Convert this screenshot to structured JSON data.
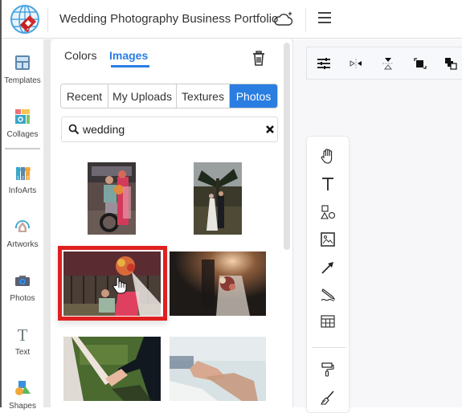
{
  "header": {
    "title": "Wedding Photography Business Portfolio",
    "logo_icon": "globe-diamond-logo",
    "cloud_icon": "cloud-sync-icon",
    "menu_icon": "hamburger-menu-icon"
  },
  "rail": {
    "items": [
      {
        "label": "Templates",
        "icon": "templates-icon"
      },
      {
        "label": "Collages",
        "icon": "collages-icon"
      },
      {
        "label": "InfoArts",
        "icon": "infoarts-icon"
      },
      {
        "label": "Artworks",
        "icon": "artworks-icon"
      },
      {
        "label": "Photos",
        "icon": "camera-icon"
      },
      {
        "label": "Text",
        "icon": "text-icon"
      },
      {
        "label": "Shapes",
        "icon": "shapes-icon"
      }
    ]
  },
  "panel": {
    "tabs": [
      {
        "label": "Colors",
        "active": false
      },
      {
        "label": "Images",
        "active": true
      }
    ],
    "trash_icon": "trash-icon",
    "sources": [
      {
        "label": "Recent",
        "active": false
      },
      {
        "label": "My Uploads",
        "active": false
      },
      {
        "label": "Textures",
        "active": false
      },
      {
        "label": "Photos",
        "active": true
      }
    ],
    "search": {
      "value": "wedding",
      "placeholder": "Search"
    },
    "results": [
      {
        "description": "Couple with wheelchair and bouquet in graffiti street",
        "orientation": "portrait",
        "selected": false
      },
      {
        "description": "Bride and groom walking under palm tree",
        "orientation": "portrait",
        "selected": false
      },
      {
        "description": "Groom and bride with colorful bouquet by graffiti fence",
        "orientation": "landscape",
        "selected": true
      },
      {
        "description": "Bride holding bouquet in warm backlight",
        "orientation": "landscape",
        "selected": false
      },
      {
        "description": "Couple holding hands on grass",
        "orientation": "landscape",
        "selected": false
      },
      {
        "description": "Hands with wedding ring double exposure",
        "orientation": "landscape",
        "selected": false
      }
    ]
  },
  "topbar": {
    "tools": [
      {
        "icon": "adjust-sliders-icon",
        "label": "Adjust"
      },
      {
        "icon": "flip-horizontal-icon",
        "label": "Flip horizontal"
      },
      {
        "icon": "flip-vertical-icon",
        "label": "Flip vertical"
      },
      {
        "icon": "bring-forward-icon",
        "label": "Bring forward"
      },
      {
        "icon": "send-backward-icon",
        "label": "Send backward"
      }
    ]
  },
  "toolbox": {
    "tools": [
      {
        "icon": "hand-pan-icon",
        "label": "Pan"
      },
      {
        "icon": "text-tool-icon",
        "label": "Text"
      },
      {
        "icon": "shapes-tool-icon",
        "label": "Shapes"
      },
      {
        "icon": "image-tool-icon",
        "label": "Image"
      },
      {
        "icon": "arrow-line-icon",
        "label": "Line"
      },
      {
        "icon": "pencil-draw-icon",
        "label": "Draw"
      },
      {
        "icon": "table-icon",
        "label": "Table"
      },
      {
        "icon": "paint-roller-icon",
        "label": "Format painter"
      },
      {
        "icon": "brush-icon",
        "label": "Brush"
      }
    ]
  },
  "colors": {
    "accent": "#2a7de1",
    "selection": "#e02020",
    "logo_red": "#d42a2a",
    "logo_blue": "#4aa3df"
  }
}
